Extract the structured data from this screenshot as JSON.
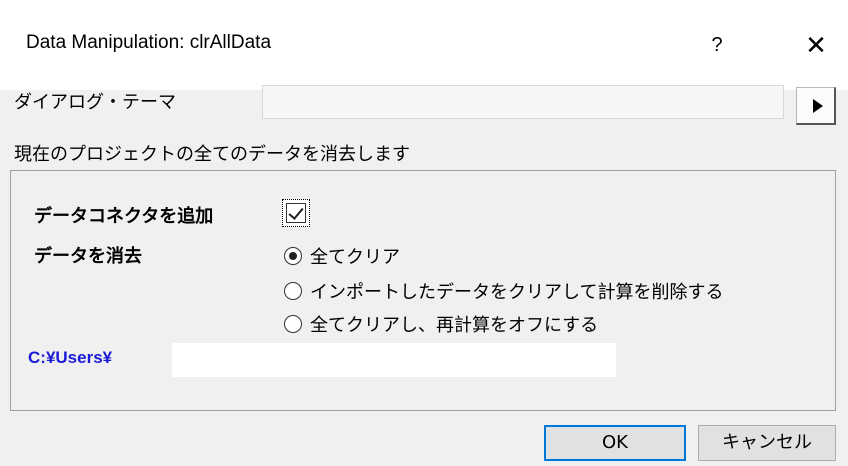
{
  "window": {
    "title": "Data Manipulation: clrAllData",
    "help_label": "?",
    "close_label": "✕"
  },
  "theme": {
    "label": "ダイアログ・テーマ",
    "value": "",
    "arrow_icon": "play-arrow-icon"
  },
  "description": "現在のプロジェクトの全てのデータを消去します",
  "options": {
    "connector_label": "データコネクタを追加",
    "connector_checked": true,
    "clear_label": "データを消去",
    "clear_choices": [
      {
        "label": "全てクリア",
        "selected": true
      },
      {
        "label": "インポートしたデータをクリアして計算を削除する",
        "selected": false
      },
      {
        "label": "全てクリアし、再計算をオフにする",
        "selected": false
      }
    ]
  },
  "path": {
    "label": "C:¥Users¥",
    "value": ""
  },
  "buttons": {
    "ok": "OK",
    "cancel": "キャンセル"
  },
  "colors": {
    "path_text": "#1a1ad8",
    "ok_border": "#0078d7"
  }
}
